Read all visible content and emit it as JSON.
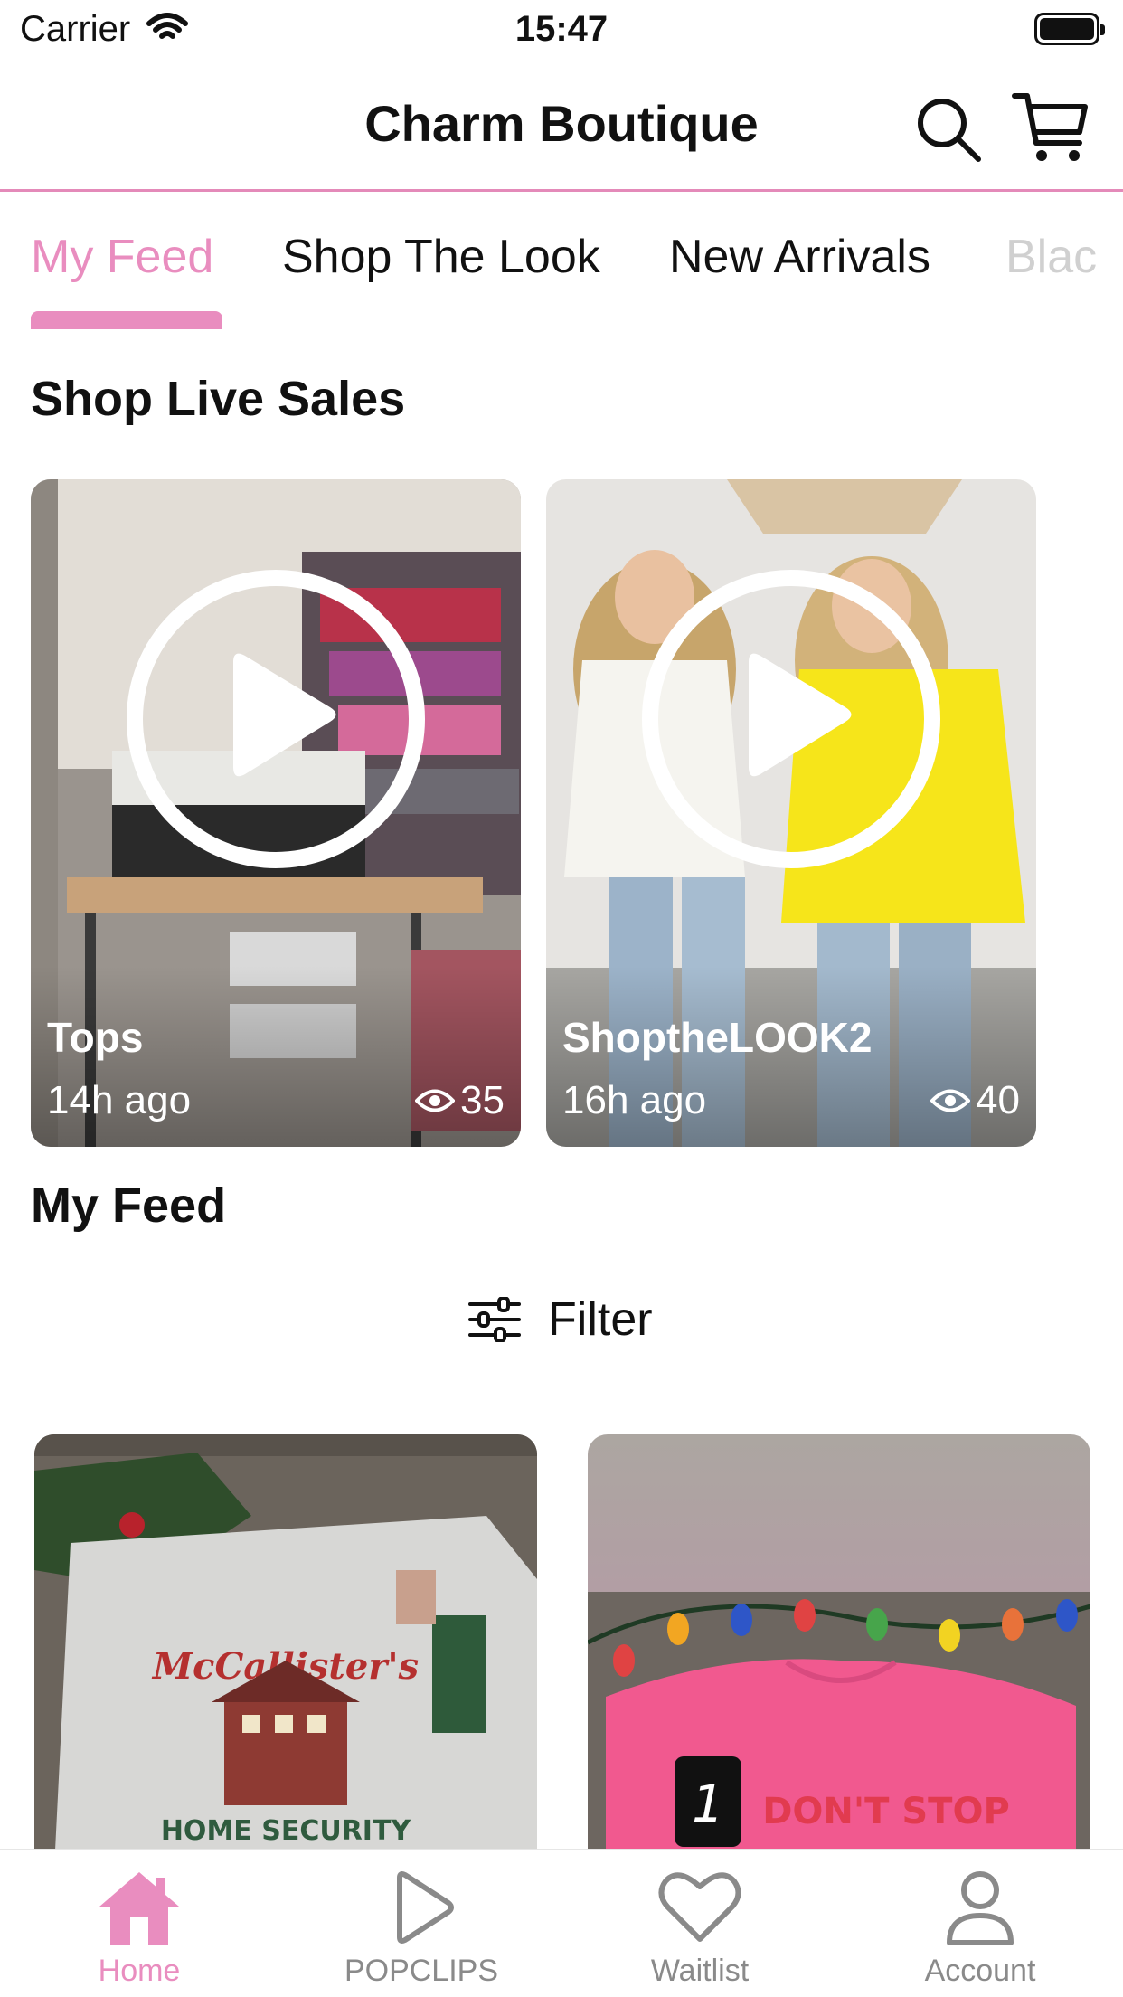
{
  "status_bar": {
    "carrier": "Carrier",
    "time": "15:47"
  },
  "header": {
    "title": "Charm Boutique"
  },
  "tabs": [
    {
      "label": "My Feed",
      "active": true
    },
    {
      "label": "Shop The Look",
      "active": false
    },
    {
      "label": "New Arrivals",
      "active": false
    },
    {
      "label": "Blac",
      "active": false
    }
  ],
  "live_sales": {
    "title": "Shop Live Sales",
    "items": [
      {
        "name": "Tops",
        "ago": "14h ago",
        "views": "35"
      },
      {
        "name": "ShoptheLOOK2",
        "ago": "16h ago",
        "views": "40"
      }
    ]
  },
  "feed": {
    "title": "My Feed",
    "filter_label": "Filter",
    "badge": "1"
  },
  "bottom_nav": [
    {
      "label": "Home",
      "icon": "home-icon",
      "active": true
    },
    {
      "label": "POPCLIPS",
      "icon": "play-icon",
      "active": false
    },
    {
      "label": "Waitlist",
      "icon": "heart-icon",
      "active": false
    },
    {
      "label": "Account",
      "icon": "person-icon",
      "active": false
    }
  ],
  "colors": {
    "accent": "#e98dbf",
    "divider": "#dddddd",
    "text": "#111111"
  }
}
